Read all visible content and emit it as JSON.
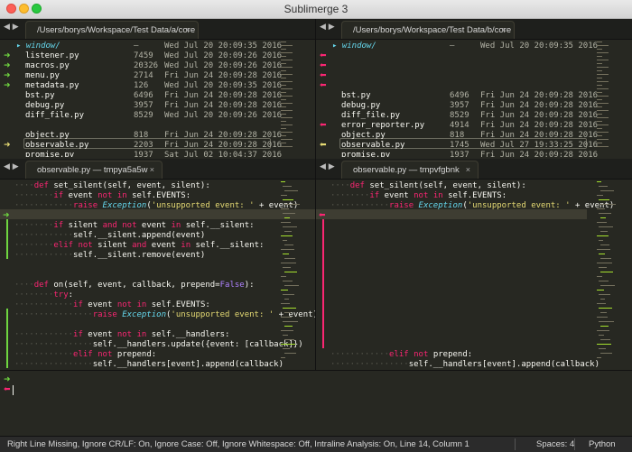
{
  "window": {
    "title": "Sublimerge 3"
  },
  "top_left_tab": "/Users/borys/Workspace/Test Data/a/core",
  "top_right_tab": "/Users/borys/Workspace/Test Data/b/core",
  "bottom_left_tab": "observable.py — tmpya5a5w",
  "bottom_right_tab": "observable.py — tmpvfgbnk",
  "close_glyph": "×",
  "nav_glyph": "◀ ▶",
  "left_files": [
    {
      "name": "▸ window/",
      "size": "–",
      "date": "Wed Jul 20 20:09:35 2016",
      "mark": "",
      "folder": true
    },
    {
      "name": "listener.py",
      "size": "7459",
      "date": "Wed Jul 20 20:09:26 2016",
      "mark": "➜"
    },
    {
      "name": "macros.py",
      "size": "20326",
      "date": "Wed Jul 20 20:09:26 2016",
      "mark": "➜"
    },
    {
      "name": "menu.py",
      "size": "2714",
      "date": "Fri Jun 24 20:09:28 2016",
      "mark": "➜"
    },
    {
      "name": "metadata.py",
      "size": "126",
      "date": "Wed Jul 20 20:09:35 2016",
      "mark": "➜"
    },
    {
      "name": "bst.py",
      "size": "6496",
      "date": "Fri Jun 24 20:09:28 2016",
      "mark": ""
    },
    {
      "name": "debug.py",
      "size": "3957",
      "date": "Fri Jun 24 20:09:28 2016",
      "mark": ""
    },
    {
      "name": "diff_file.py",
      "size": "8529",
      "date": "Wed Jul 20 20:09:26 2016",
      "mark": ""
    },
    {
      "name": "",
      "size": "",
      "date": "",
      "mark": ""
    },
    {
      "name": "object.py",
      "size": "818",
      "date": "Fri Jun 24 20:09:28 2016",
      "mark": ""
    },
    {
      "name": "observable.py",
      "size": "2203",
      "date": "Fri Jun 24 20:09:28 2016",
      "mark": "➜"
    },
    {
      "name": "promise.py",
      "size": "1937",
      "date": "Sat Jul 02 10:04:37 2016",
      "mark": ""
    }
  ],
  "right_files": [
    {
      "name": "▸ window/",
      "size": "–",
      "date": "Wed Jul 20 20:09:35 2016",
      "mark": "",
      "folder": true
    },
    {
      "name": "",
      "size": "",
      "date": "",
      "mark": "⬅"
    },
    {
      "name": "",
      "size": "",
      "date": "",
      "mark": "⬅"
    },
    {
      "name": "",
      "size": "",
      "date": "",
      "mark": "⬅"
    },
    {
      "name": "",
      "size": "",
      "date": "",
      "mark": "⬅"
    },
    {
      "name": "bst.py",
      "size": "6496",
      "date": "Fri Jun 24 20:09:28 2016",
      "mark": ""
    },
    {
      "name": "debug.py",
      "size": "3957",
      "date": "Fri Jun 24 20:09:28 2016",
      "mark": ""
    },
    {
      "name": "diff_file.py",
      "size": "8529",
      "date": "Fri Jun 24 20:09:28 2016",
      "mark": ""
    },
    {
      "name": "error_reporter.py",
      "size": "4914",
      "date": "Fri Jun 24 20:09:28 2016",
      "mark": "⬅"
    },
    {
      "name": "object.py",
      "size": "818",
      "date": "Fri Jun 24 20:09:28 2016",
      "mark": ""
    },
    {
      "name": "observable.py",
      "size": "1745",
      "date": "Wed Jul 27 19:33:25 2016",
      "mark": "⬅"
    },
    {
      "name": "promise.py",
      "size": "1937",
      "date": "Fri Jun 24 20:09:28 2016",
      "mark": ""
    }
  ],
  "left_code": [
    "····def set_silent(self, event, silent):",
    "········if event not in self.EVENTS:",
    "············raise Exception('unsupported event: ' + event)",
    "",
    "········if silent and not event in self.__silent:",
    "············self.__silent.append(event)",
    "········elif not silent and event in self.__silent:",
    "············self.__silent.remove(event)",
    "",
    "",
    "····def on(self, event, callback, prepend=False):",
    "········try:",
    "············if event not in self.EVENTS:",
    "················raise Exception('unsupported event: ' + event)",
    "",
    "············if event not in self.__handlers:",
    "················self.__handlers.update({event: [callback]})",
    "············elif not prepend:",
    "················self.__handlers[event].append(callback)"
  ],
  "right_code": [
    "····def set_silent(self, event, silent):",
    "········if event not in self.EVENTS:",
    "············raise Exception('unsupported event: ' + event)",
    "",
    "",
    "",
    "",
    "",
    "",
    "",
    "",
    "",
    "",
    "",
    "",
    "",
    "",
    "············elif not prepend:",
    "················self.__handlers[event].append(callback)"
  ],
  "status": {
    "main": "Right Line Missing, Ignore CR/LF: On, Ignore Case: Off, Ignore Whitespace: Off, Intraline Analysis: On, Line 14, Column 1",
    "spaces": "Spaces: 4",
    "syntax": "Python"
  },
  "colors": {
    "background": "#272822",
    "added": "#6fd640",
    "removed": "#f92672",
    "keyword": "#f92672",
    "function": "#a6e22e",
    "string": "#e6db74"
  }
}
